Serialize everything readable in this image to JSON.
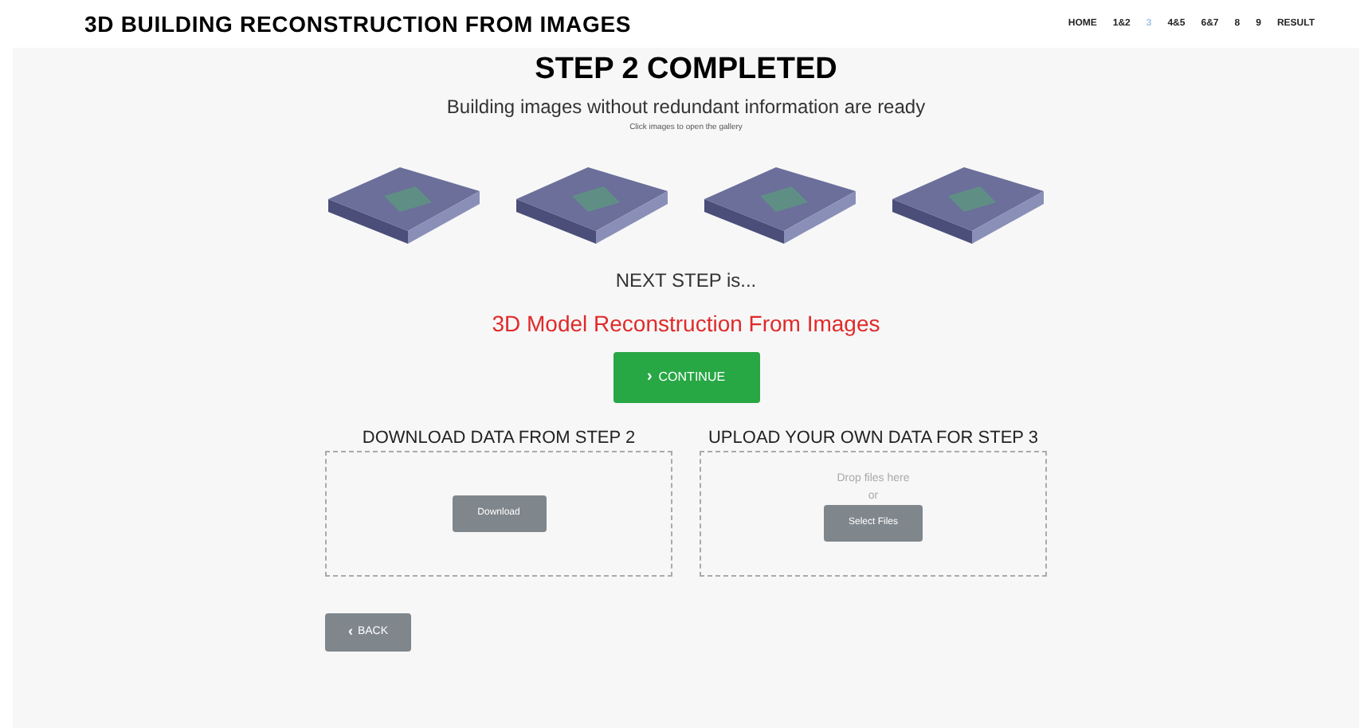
{
  "header": {
    "title": "3D BUILDING RECONSTRUCTION FROM IMAGES",
    "nav": [
      {
        "label": "HOME",
        "selected": false
      },
      {
        "label": "1&2",
        "selected": false
      },
      {
        "label": "3",
        "selected": true
      },
      {
        "label": "4&5",
        "selected": false
      },
      {
        "label": "6&7",
        "selected": false
      },
      {
        "label": "8",
        "selected": false
      },
      {
        "label": "9",
        "selected": false
      },
      {
        "label": "RESULT",
        "selected": false
      }
    ]
  },
  "title": "STEP 2 COMPLETED",
  "subtitle": "Building images without redundant information are ready",
  "gallery_hint": "Click images to open the gallery",
  "gallery": [
    {
      "kind": "photo"
    },
    {
      "kind": "photo"
    },
    {
      "kind": "photo"
    },
    {
      "kind": "photo"
    }
  ],
  "next_label": "NEXT STEP is...",
  "next_step": "3D Model Reconstruction From Images",
  "continue_icon": "›",
  "continue": "CONTINUE",
  "download": {
    "heading": "DOWNLOAD DATA FROM STEP 2",
    "button": "Download"
  },
  "upload": {
    "heading": "UPLOAD YOUR OWN DATA FOR STEP 3",
    "drop": "Drop files here",
    "or": "or",
    "button": "Select Files"
  },
  "back_icon": "‹",
  "back": "BACK"
}
